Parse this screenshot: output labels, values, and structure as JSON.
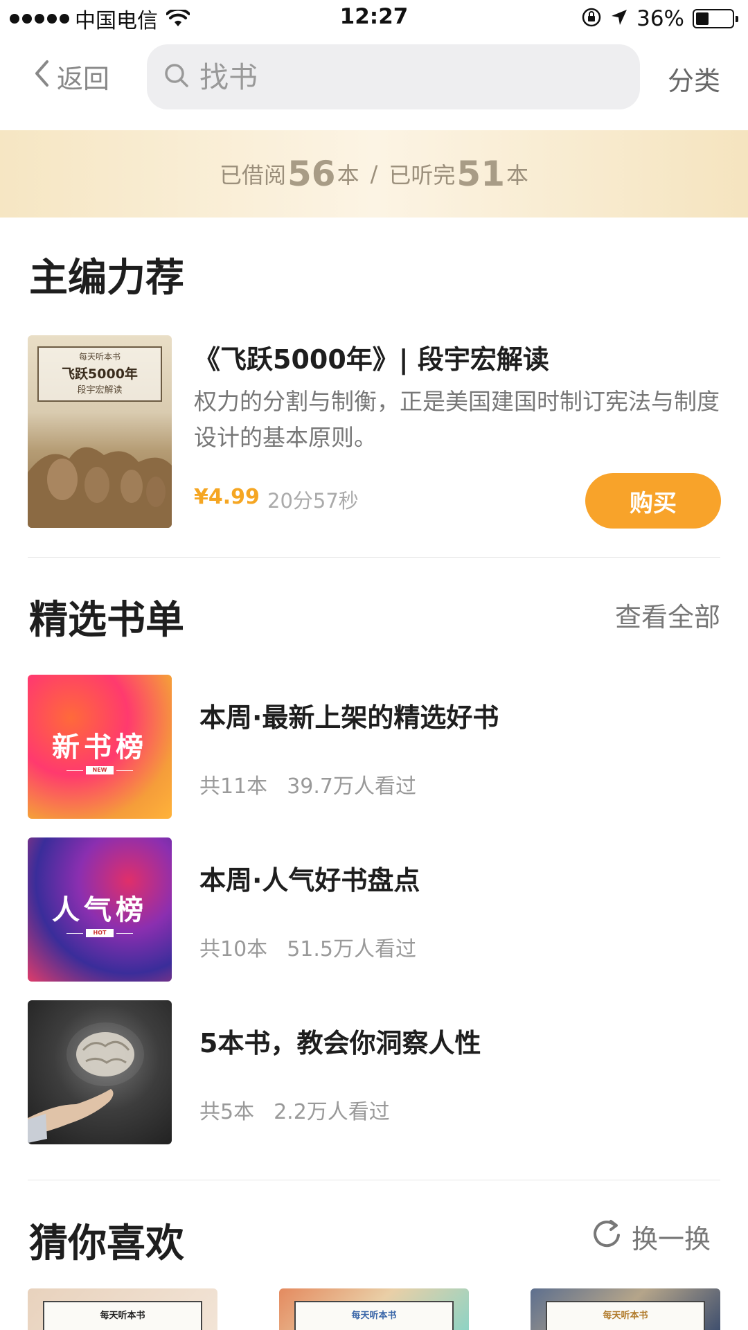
{
  "status_bar": {
    "carrier": "中国电信",
    "time": "12:27",
    "battery_percent": "36%",
    "battery_level": 0.36
  },
  "nav": {
    "back_label": "返回",
    "search_placeholder": "找书",
    "category_label": "分类"
  },
  "banner": {
    "borrowed_prefix": "已借阅",
    "borrowed_count": "56",
    "borrowed_unit": "本",
    "separator": "/",
    "finished_prefix": "已听完",
    "finished_count": "51",
    "finished_unit": "本"
  },
  "featured": {
    "section_title": "主编力荐",
    "cover_brand": "每天听本书",
    "cover_title": "飞跃5000年",
    "cover_subtitle": "段宇宏解读",
    "title": "《飞跃5000年》| 段宇宏解读",
    "description": "权力的分割与制衡，正是美国建国时制订宪法与制度设计的基本原则。",
    "price": "¥4.99",
    "duration": "20分57秒",
    "buy_label": "购买"
  },
  "booklists": {
    "section_title": "精选书单",
    "view_all_label": "查看全部",
    "items": [
      {
        "cover_text": "新书榜",
        "cover_tag": "NEW",
        "title": "本周·最新上架的精选好书",
        "count": "共11本",
        "views": "39.7万人看过"
      },
      {
        "cover_text": "人气榜",
        "cover_tag": "HOT",
        "title": "本周·人气好书盘点",
        "count": "共10本",
        "views": "51.5万人看过"
      },
      {
        "cover_text": "",
        "cover_tag": "",
        "title": "5本书，教会你洞察人性",
        "count": "共5本",
        "views": "2.2万人看过"
      }
    ]
  },
  "guess": {
    "section_title": "猜你喜欢",
    "refresh_label": "换一换",
    "covers": [
      {
        "brand": "每天听本书"
      },
      {
        "brand": "每天听本书"
      },
      {
        "brand": "每天听本书"
      }
    ]
  },
  "colors": {
    "accent": "#f8a32a",
    "banner_bg": "#f6e6c3",
    "text_primary": "#1e1e1e",
    "text_secondary": "#999999"
  }
}
